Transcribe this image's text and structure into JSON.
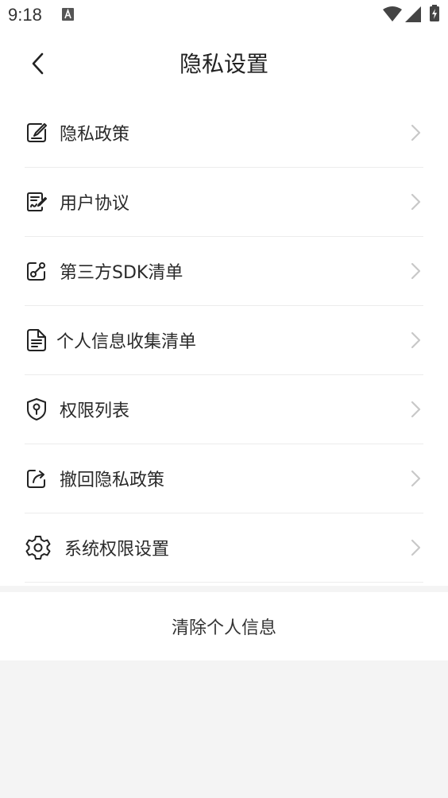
{
  "status_bar": {
    "time": "9:18",
    "icons": [
      "text-a-icon",
      "wifi-icon",
      "signal-icon",
      "battery-icon"
    ]
  },
  "header": {
    "back_icon": "chevron-left-icon",
    "title": "隐私设置"
  },
  "menu": {
    "items": [
      {
        "label": "隐私政策",
        "icon": "edit-document-icon"
      },
      {
        "label": "用户协议",
        "icon": "signature-document-icon"
      },
      {
        "label": "第三方SDK清单",
        "icon": "share-link-icon"
      },
      {
        "label": "个人信息收集清单",
        "icon": "document-list-icon"
      },
      {
        "label": "权限列表",
        "icon": "shield-key-icon"
      },
      {
        "label": "撤回隐私政策",
        "icon": "export-arrow-icon"
      },
      {
        "label": "系统权限设置",
        "icon": "gear-icon"
      }
    ],
    "chevron_icon": "chevron-right-icon"
  },
  "actions": {
    "clear_personal_info": "清除个人信息"
  },
  "colors": {
    "background": "#f4f4f4",
    "card": "#ffffff",
    "text": "#222222",
    "chevron": "#c8c8c8",
    "divider": "#ececec"
  }
}
